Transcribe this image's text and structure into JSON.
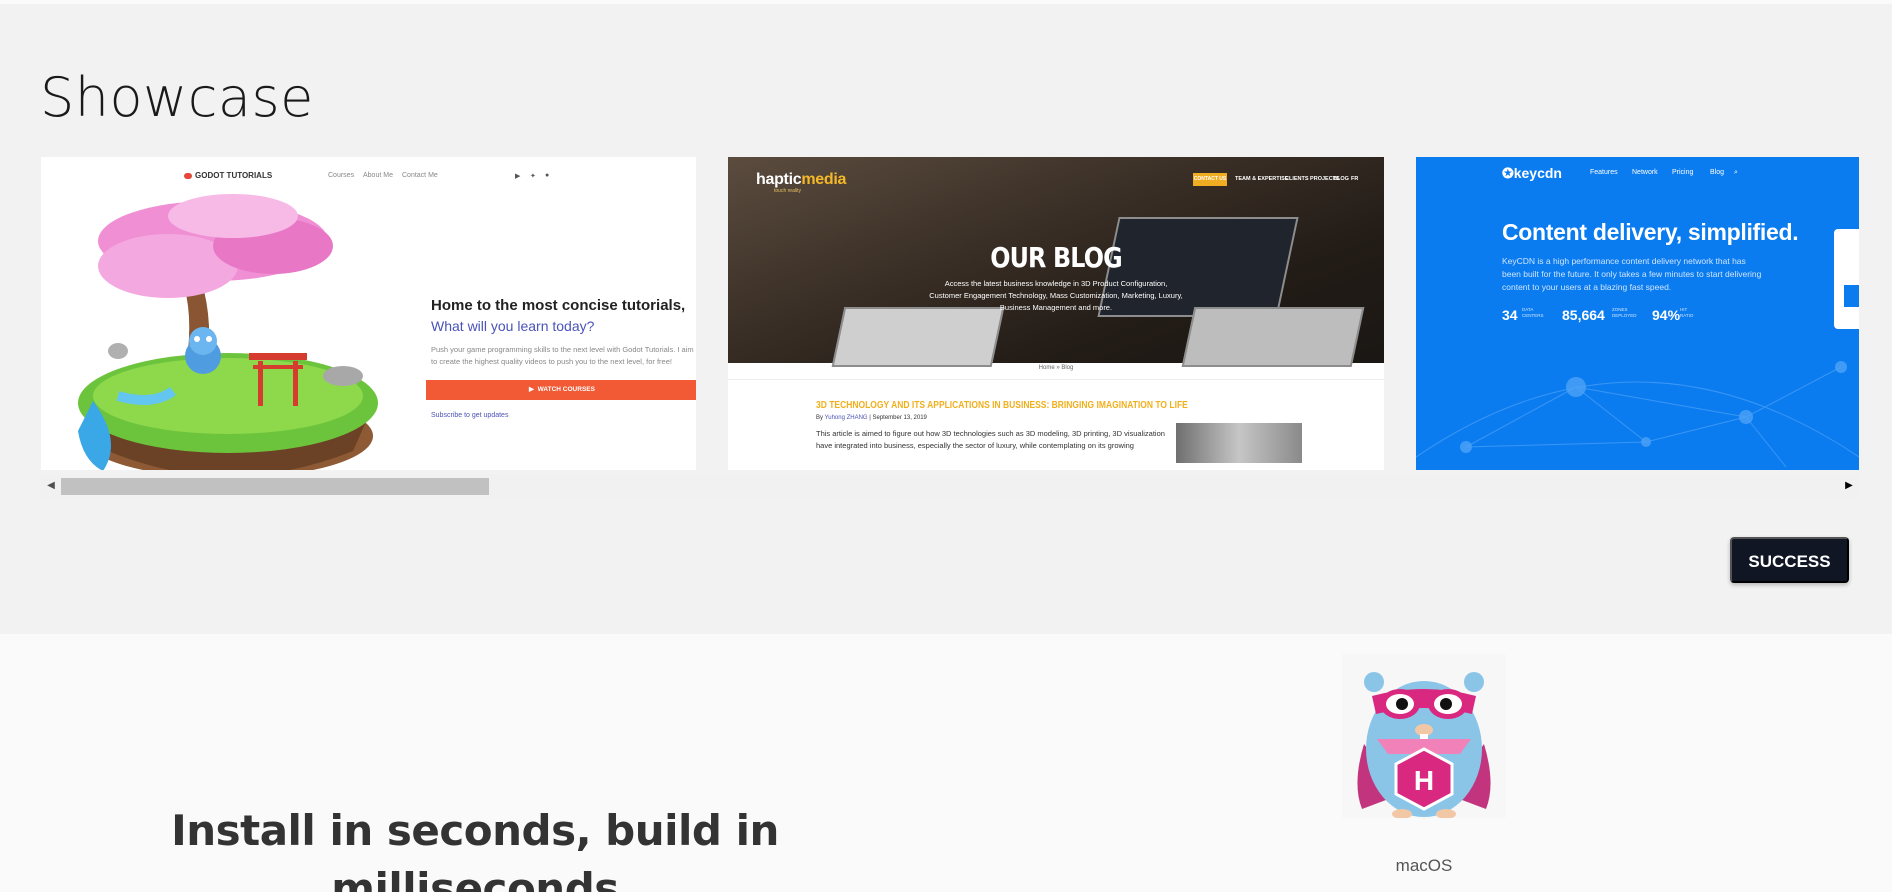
{
  "showcase": {
    "title": "Showcase",
    "cards": [
      {
        "logo": "GODOT TUTORIALS",
        "nav": [
          "Courses",
          "About Me",
          "Contact Me"
        ],
        "heading": "Home to the most concise tutorials,",
        "subheading": "What will you learn today?",
        "text": "Push your game programming skills to the next level with Godot Tutorials. I aim to create the highest quality videos to push you to the next level, for free!",
        "button": "WATCH COURSES",
        "link": "Subscribe to get updates"
      },
      {
        "logo_main": "haptic",
        "logo_accent": "media",
        "logo_sub": "touch reality",
        "nav_contact": "CONTACT US",
        "nav": [
          "TEAM & EXPERTISE",
          "CLIENTS PROJECTS",
          "BLOG",
          "FR"
        ],
        "title": "OUR BLOG",
        "desc": "Access the latest business knowledge in 3D Product Configuration, Customer Engagement Technology, Mass Customization, Marketing, Luxury, Business Management and more.",
        "breadcrumb": "Home » Blog",
        "article_title": "3D TECHNOLOGY AND ITS APPLICATIONS IN BUSINESS: BRINGING IMAGINATION TO LIFE",
        "article_by": "By",
        "article_author": "Yuhong ZHANG",
        "article_date": "| September 13, 2019",
        "article_text": "This article is aimed to figure out how 3D technologies such as 3D modeling, 3D printing, 3D visualization have integrated into business, especially the sector of luxury, while contemplating on its growing"
      },
      {
        "logo": "keycdn",
        "nav": [
          "Features",
          "Network",
          "Pricing",
          "Blog"
        ],
        "heading": "Content delivery, simplified.",
        "text": "KeyCDN is a high performance content delivery network that has been built for the future. It only takes a few minutes to start delivering content to your users at a blazing fast speed.",
        "stats": [
          {
            "value": "34",
            "label": "DATA CENTERS"
          },
          {
            "value": "85,664",
            "label": "ZONES DEPLOYED"
          },
          {
            "value": "94%",
            "label": "HIT RATIO"
          }
        ]
      }
    ],
    "scroll_left": "◀",
    "scroll_right": "▶",
    "success_label": "SUCCESS"
  },
  "install": {
    "heading": "Install in seconds, build in milliseconds",
    "os_label": "macOS"
  },
  "colors": {
    "showcase_bg": "#f2f2f2",
    "success_bg": "#101624",
    "godot_accent": "#f15a35",
    "haptic_accent": "#f4b829",
    "keycdn_blue": "#0b7cf0"
  }
}
